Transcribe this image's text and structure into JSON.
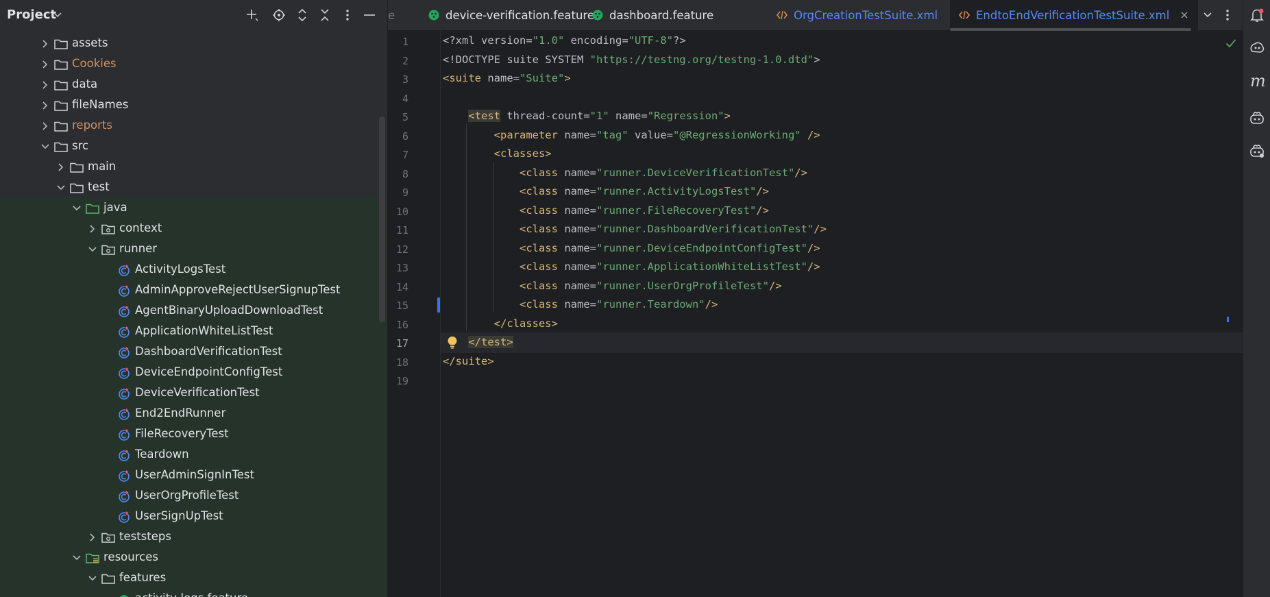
{
  "sidebar": {
    "title": "Project",
    "toolbar_icons": [
      "add-icon",
      "locate-icon",
      "expand-all-icon",
      "collapse-all-icon",
      "more-icon",
      "minimize-icon"
    ],
    "tree": [
      {
        "label": "assets",
        "type": "folder",
        "expanded": false
      },
      {
        "label": "Cookies",
        "type": "folder",
        "expanded": false,
        "color": "#d5915f"
      },
      {
        "label": "data",
        "type": "folder",
        "expanded": false
      },
      {
        "label": "fileNames",
        "type": "folder",
        "expanded": false
      },
      {
        "label": "reports",
        "type": "folder",
        "expanded": false,
        "color": "#d5915f"
      },
      {
        "label": "src",
        "type": "folder",
        "expanded": true
      },
      {
        "label": "main",
        "type": "folder",
        "expanded": false
      },
      {
        "label": "test",
        "type": "folder",
        "expanded": true
      },
      {
        "label": "java",
        "type": "source-folder",
        "expanded": true
      },
      {
        "label": "context",
        "type": "package",
        "expanded": false
      },
      {
        "label": "runner",
        "type": "package",
        "expanded": true
      },
      {
        "label": "ActivityLogsTest",
        "type": "class"
      },
      {
        "label": "AdminApproveRejectUserSignupTest",
        "type": "class"
      },
      {
        "label": "AgentBinaryUploadDownloadTest",
        "type": "class"
      },
      {
        "label": "ApplicationWhiteListTest",
        "type": "class"
      },
      {
        "label": "DashboardVerificationTest",
        "type": "class"
      },
      {
        "label": "DeviceEndpointConfigTest",
        "type": "class"
      },
      {
        "label": "DeviceVerificationTest",
        "type": "class"
      },
      {
        "label": "End2EndRunner",
        "type": "class"
      },
      {
        "label": "FileRecoveryTest",
        "type": "class"
      },
      {
        "label": "Teardown",
        "type": "class"
      },
      {
        "label": "UserAdminSignInTest",
        "type": "class"
      },
      {
        "label": "UserOrgProfileTest",
        "type": "class"
      },
      {
        "label": "UserSignUpTest",
        "type": "class"
      },
      {
        "label": "teststeps",
        "type": "package",
        "expanded": false
      },
      {
        "label": "resources",
        "type": "resources-folder",
        "expanded": true
      },
      {
        "label": "features",
        "type": "folder",
        "expanded": true
      },
      {
        "label": "activity-logs.feature",
        "type": "feature"
      }
    ]
  },
  "tabs": [
    {
      "label": "e",
      "type": "partial"
    },
    {
      "label": "device-verification.feature",
      "type": "feature"
    },
    {
      "label": "dashboard.feature",
      "type": "feature"
    },
    {
      "label": "OrgCreationTestSuite.xml",
      "type": "xml"
    },
    {
      "label": "EndtoEndVerificationTestSuite.xml",
      "type": "xml",
      "active": true
    }
  ],
  "editor": {
    "line_numbers": [
      "1",
      "2",
      "3",
      "4",
      "5",
      "6",
      "7",
      "8",
      "9",
      "10",
      "11",
      "12",
      "13",
      "14",
      "15",
      "16",
      "17",
      "18",
      "19"
    ],
    "current_line": "17",
    "lines": [
      [
        {
          "t": "<?xml ",
          "c": "plain"
        },
        {
          "t": "version=",
          "c": "attr"
        },
        {
          "t": "\"1.0\"",
          "c": "str"
        },
        {
          "t": " encoding=",
          "c": "attr"
        },
        {
          "t": "\"UTF-8\"",
          "c": "str"
        },
        {
          "t": "?>",
          "c": "plain"
        }
      ],
      [
        {
          "t": "<!DOCTYPE suite SYSTEM ",
          "c": "plain"
        },
        {
          "t": "\"https://testng.org/testng-1.0.dtd\"",
          "c": "str"
        },
        {
          "t": ">",
          "c": "plain"
        }
      ],
      [
        {
          "t": "<suite ",
          "c": "tag"
        },
        {
          "t": "name=",
          "c": "attr"
        },
        {
          "t": "\"Suite\"",
          "c": "str"
        },
        {
          "t": ">",
          "c": "tag"
        }
      ],
      [],
      [
        {
          "t": "    "
        },
        {
          "t": "<test",
          "c": "tag",
          "hl": true
        },
        {
          "t": " thread-count=",
          "c": "attr"
        },
        {
          "t": "\"1\"",
          "c": "str"
        },
        {
          "t": " name=",
          "c": "attr"
        },
        {
          "t": "\"Regression\"",
          "c": "str"
        },
        {
          "t": ">",
          "c": "tag"
        }
      ],
      [
        {
          "t": "        "
        },
        {
          "t": "<parameter ",
          "c": "tag"
        },
        {
          "t": "name=",
          "c": "attr"
        },
        {
          "t": "\"tag\"",
          "c": "str"
        },
        {
          "t": " value=",
          "c": "attr"
        },
        {
          "t": "\"@RegressionWorking\"",
          "c": "str"
        },
        {
          "t": " />",
          "c": "tag"
        }
      ],
      [
        {
          "t": "        "
        },
        {
          "t": "<classes>",
          "c": "tag"
        }
      ],
      [
        {
          "t": "            "
        },
        {
          "t": "<class ",
          "c": "tag"
        },
        {
          "t": "name=",
          "c": "attr"
        },
        {
          "t": "\"runner.DeviceVerificationTest\"",
          "c": "str"
        },
        {
          "t": "/>",
          "c": "tag"
        }
      ],
      [
        {
          "t": "            "
        },
        {
          "t": "<class ",
          "c": "tag"
        },
        {
          "t": "name=",
          "c": "attr"
        },
        {
          "t": "\"runner.ActivityLogsTest\"",
          "c": "str"
        },
        {
          "t": "/>",
          "c": "tag"
        }
      ],
      [
        {
          "t": "            "
        },
        {
          "t": "<class ",
          "c": "tag"
        },
        {
          "t": "name=",
          "c": "attr"
        },
        {
          "t": "\"runner.FileRecoveryTest\"",
          "c": "str"
        },
        {
          "t": "/>",
          "c": "tag"
        }
      ],
      [
        {
          "t": "            "
        },
        {
          "t": "<class ",
          "c": "tag"
        },
        {
          "t": "name=",
          "c": "attr"
        },
        {
          "t": "\"runner.DashboardVerificationTest\"",
          "c": "str"
        },
        {
          "t": "/>",
          "c": "tag"
        }
      ],
      [
        {
          "t": "            "
        },
        {
          "t": "<class ",
          "c": "tag"
        },
        {
          "t": "name=",
          "c": "attr"
        },
        {
          "t": "\"runner.DeviceEndpointConfigTest\"",
          "c": "str"
        },
        {
          "t": "/>",
          "c": "tag"
        }
      ],
      [
        {
          "t": "            "
        },
        {
          "t": "<class ",
          "c": "tag"
        },
        {
          "t": "name=",
          "c": "attr"
        },
        {
          "t": "\"runner.ApplicationWhiteListTest\"",
          "c": "str"
        },
        {
          "t": "/>",
          "c": "tag"
        }
      ],
      [
        {
          "t": "            "
        },
        {
          "t": "<class ",
          "c": "tag"
        },
        {
          "t": "name=",
          "c": "attr"
        },
        {
          "t": "\"runner.UserOrgProfileTest\"",
          "c": "str"
        },
        {
          "t": "/>",
          "c": "tag"
        }
      ],
      [
        {
          "t": "            "
        },
        {
          "t": "<class ",
          "c": "tag"
        },
        {
          "t": "name=",
          "c": "attr"
        },
        {
          "t": "\"runner.Teardown\"",
          "c": "str"
        },
        {
          "t": "/>",
          "c": "tag"
        }
      ],
      [
        {
          "t": "        "
        },
        {
          "t": "</classes>",
          "c": "tag"
        }
      ],
      [
        {
          "t": "    "
        },
        {
          "t": "</test>",
          "c": "tag",
          "hl": true
        }
      ],
      [
        {
          "t": "</suite>",
          "c": "tag"
        }
      ],
      []
    ]
  },
  "colors": {
    "tag": "#d5b778",
    "string": "#6aab73",
    "plain": "#bcbec4",
    "orange_folder": "#d5915f",
    "xml_tab": "#548af7",
    "tree_highlight": "#26332b"
  },
  "right_strip_icons": [
    "notifications-icon",
    "ai-assistant-icon",
    "maven-icon",
    "copilot-icon",
    "copilot-chat-icon"
  ],
  "status": {
    "inspection": "checkmark-icon"
  }
}
